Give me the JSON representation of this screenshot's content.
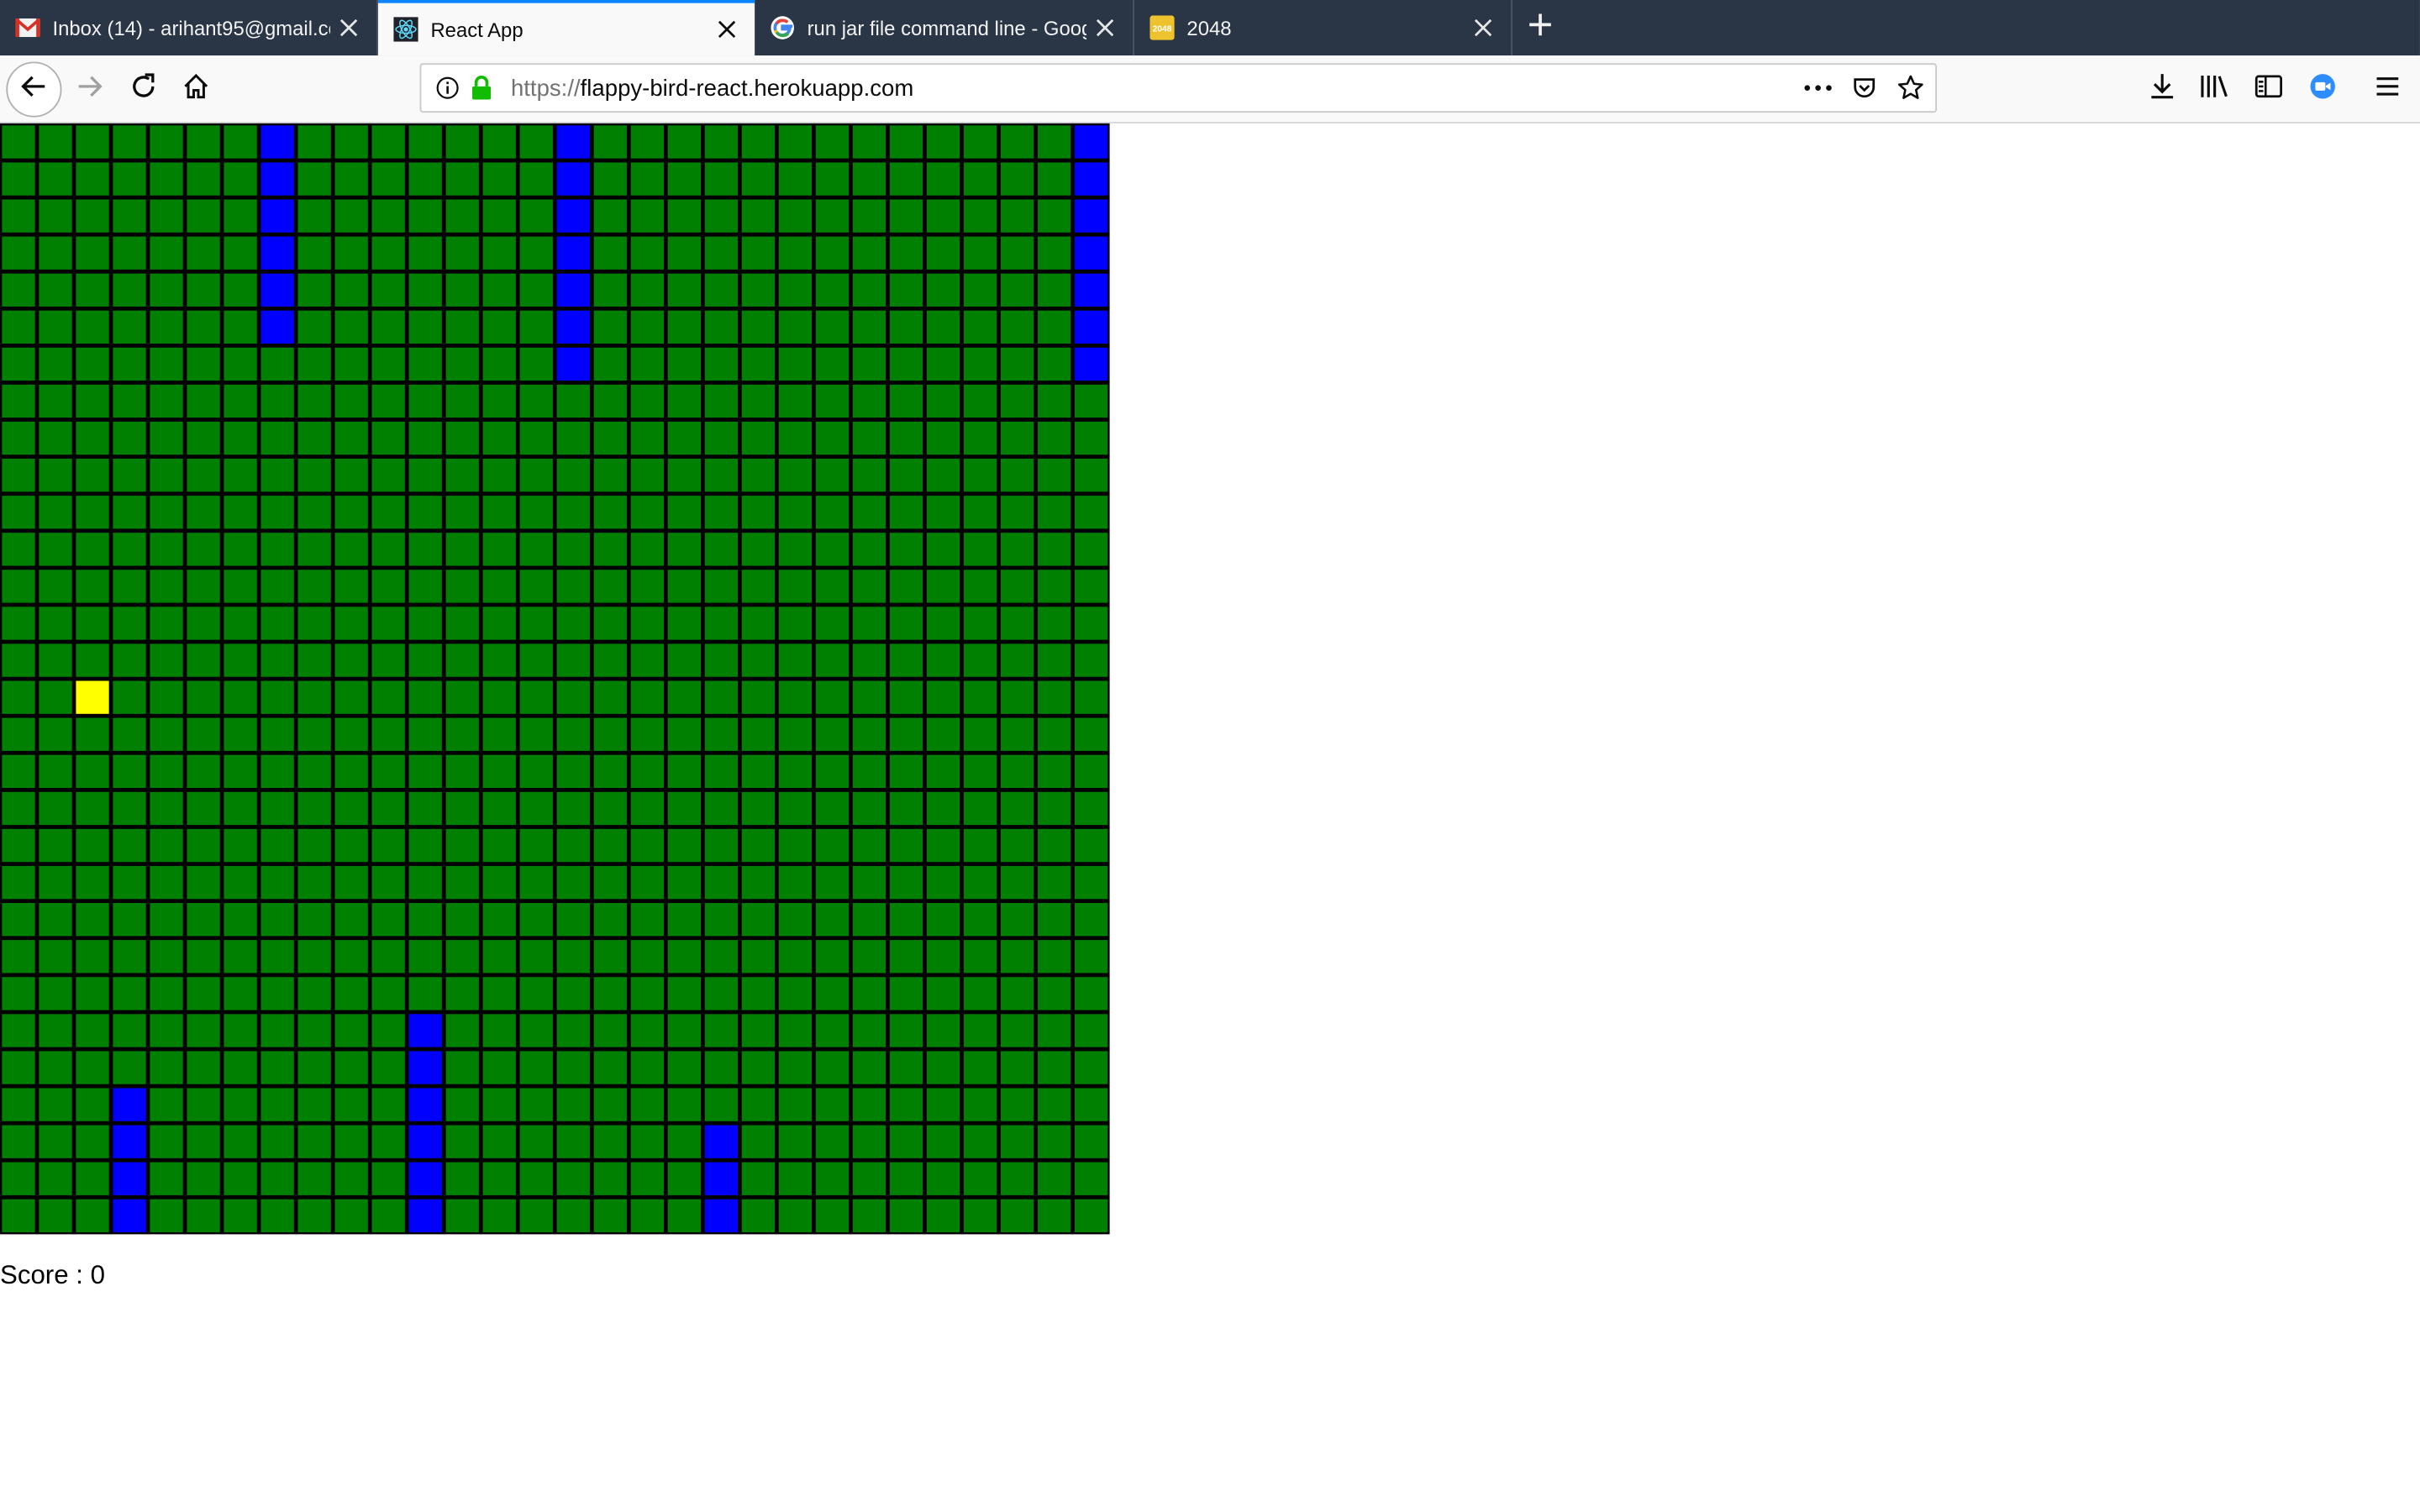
{
  "browser": {
    "tabs": [
      {
        "label": "Inbox (14) - arihant95@gmail.com - Gmail",
        "icon": "gmail-icon",
        "active": false
      },
      {
        "label": "React App",
        "icon": "react-icon",
        "active": true
      },
      {
        "label": "run jar file command line - Google Search",
        "icon": "google-icon",
        "active": false
      },
      {
        "label": "2048",
        "icon": "2048-icon",
        "active": false
      }
    ],
    "url_scheme": "https://",
    "url_host": "flappy-bird-react.herokuapp.com"
  },
  "game": {
    "grid_cols": 30,
    "grid_rows": 30,
    "cell_color": "#008000",
    "pipe_color": "#0000ff",
    "bird_color": "#ffff00",
    "line_color": "#000000",
    "bird": {
      "col": 2,
      "row": 15
    },
    "pipes": [
      {
        "col": 7,
        "from": "top",
        "length": 6
      },
      {
        "col": 15,
        "from": "top",
        "length": 7
      },
      {
        "col": 29,
        "from": "top",
        "length": 7
      },
      {
        "col": 3,
        "from": "bottom",
        "length": 4
      },
      {
        "col": 11,
        "from": "bottom",
        "length": 6
      },
      {
        "col": 19,
        "from": "bottom",
        "length": 3
      }
    ]
  },
  "score": {
    "label": "Score : ",
    "value": "0"
  },
  "colors": {
    "tab_active_accent": "#0a84ff",
    "tabstrip_bg": "#2a3545",
    "lock": "#12bc00"
  }
}
